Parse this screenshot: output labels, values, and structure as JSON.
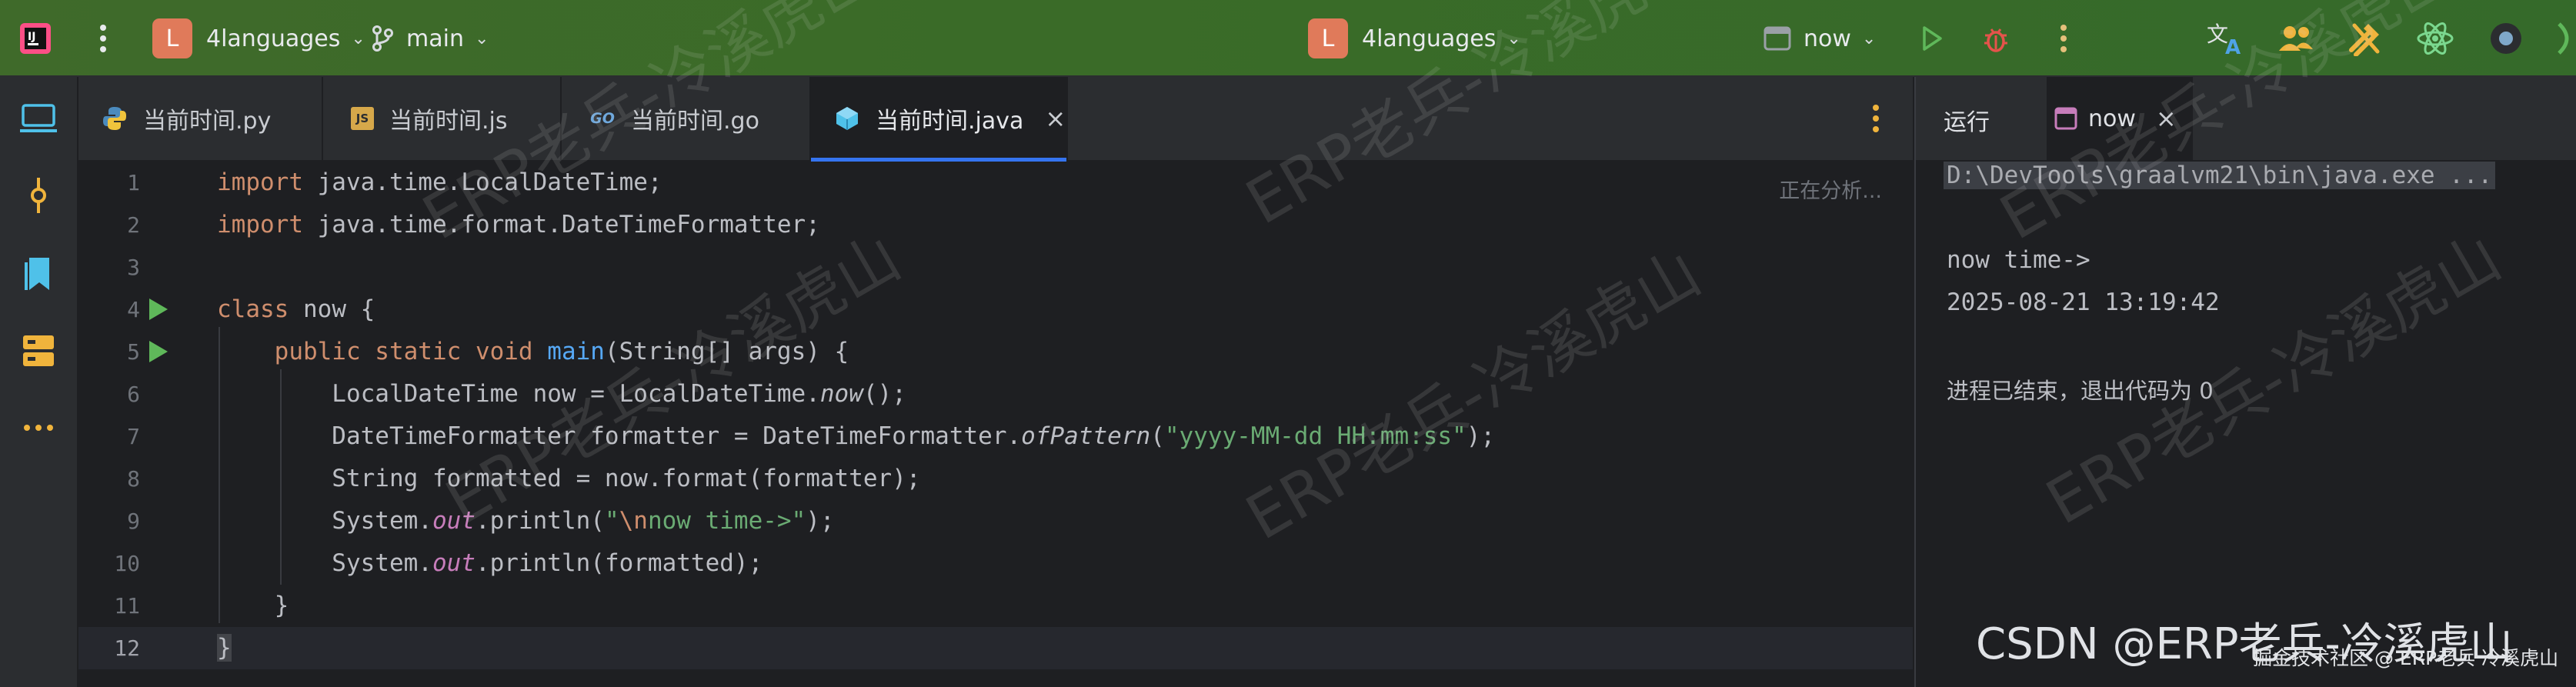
{
  "titlebar": {
    "project_initial": "L",
    "project_name": "4languages",
    "branch": "main",
    "center_project_initial": "L",
    "center_project_name": "4languages",
    "run_config": "now"
  },
  "tabs": [
    {
      "label": "当前时间.py"
    },
    {
      "label": "当前时间.js",
      "icon_text": "JS"
    },
    {
      "label": "当前时间.go",
      "icon_text": "GO"
    },
    {
      "label": "当前时间.java",
      "close": "×"
    }
  ],
  "editor": {
    "analysis_status": "正在分析...",
    "line_numbers": [
      "1",
      "2",
      "3",
      "4",
      "5",
      "6",
      "7",
      "8",
      "9",
      "10",
      "11",
      "12"
    ]
  },
  "run_panel": {
    "tab_run": "运行",
    "tab_config": "now",
    "close": "×",
    "lines": [
      "D:\\DevTools\\graalvm21\\bin\\java.exe ...",
      "",
      "now time->",
      "2025-08-21 13:19:42",
      "",
      "进程已结束，退出代码为 0"
    ]
  },
  "watermark": {
    "text": "ERP老兵-冷溪虎山"
  },
  "footer": {
    "csdn": "CSDN @ERP老兵-冷溪虎山",
    "small": "掘金技术社区 @ ERP老兵 冷溪虎山"
  },
  "colors": {
    "accent": "#3574f0",
    "run": "#5fb85a",
    "debug": "#e5534b",
    "titlebar": "#3a6b28"
  }
}
